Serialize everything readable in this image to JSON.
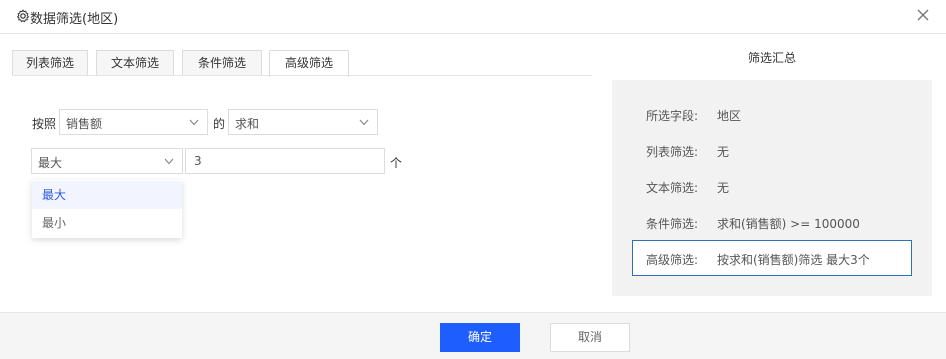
{
  "dialog": {
    "title": "数据筛选(地区)"
  },
  "tabs": [
    {
      "label": "列表筛选"
    },
    {
      "label": "文本筛选"
    },
    {
      "label": "条件筛选"
    },
    {
      "label": "高级筛选",
      "active": true
    }
  ],
  "advanced": {
    "by_label": "按照",
    "field_select": "销售额",
    "of_label": "的",
    "agg_select": "求和",
    "mode_select": "最大",
    "count_value": "3",
    "unit_label": "个",
    "mode_options": [
      "最大",
      "最小"
    ]
  },
  "summary": {
    "title": "筛选汇总",
    "rows": [
      {
        "key": "所选字段:",
        "value": "地区"
      },
      {
        "key": "列表筛选:",
        "value": "无"
      },
      {
        "key": "文本筛选:",
        "value": "无"
      },
      {
        "key": "条件筛选:",
        "value": "求和(销售额) >= 100000"
      },
      {
        "key": "高级筛选:",
        "value": "按求和(销售额)筛选 最大3个"
      }
    ]
  },
  "footer": {
    "ok_label": "确定",
    "cancel_label": "取消"
  },
  "colors": {
    "primary": "#1e5eff",
    "highlight_border": "#2f6fb5",
    "summary_bg": "#f2f2f2"
  }
}
